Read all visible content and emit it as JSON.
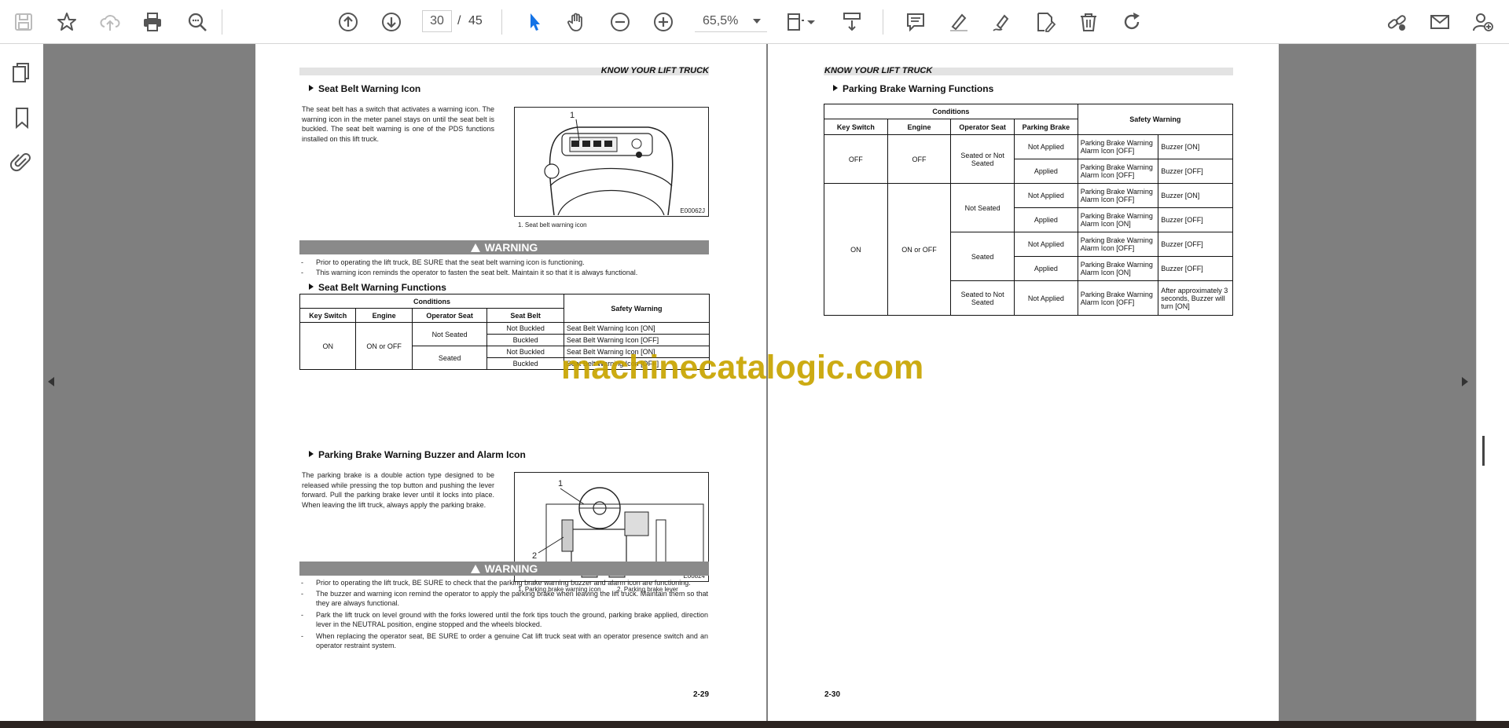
{
  "toolbar": {
    "page_current": "30",
    "page_separator": "/",
    "page_total": "45",
    "zoom": "65,5%"
  },
  "left_page": {
    "header": "KNOW YOUR LIFT TRUCK",
    "sec1_title": "Seat Belt Warning Icon",
    "sec1_para": "The seat belt has a switch that activates a warning icon. The warning icon in the meter panel stays on until the seat belt is buckled. The seat belt warning is one of the PDS functions installed on this lift truck.",
    "fig1_callout": "1",
    "fig1_code": "E00062J",
    "fig1_caption": "1.  Seat belt warning icon",
    "warning1_label": "WARNING",
    "warning1_items": [
      "Prior to operating the lift truck, BE SURE that the seat belt warning icon is functioning.",
      "This warning icon reminds the operator to fasten the seat belt. Maintain it so that it is always functional."
    ],
    "sec2_title": "Seat Belt Warning Functions",
    "table1": {
      "conditions": "Conditions",
      "safety_warning": "Safety Warning",
      "col_key": "Key Switch",
      "col_engine": "Engine",
      "col_seat": "Operator Seat",
      "col_belt": "Seat Belt",
      "key_on": "ON",
      "engine_on_off": "ON or OFF",
      "not_seated": "Not Seated",
      "seated": "Seated",
      "rows": [
        {
          "belt": "Not Buckled",
          "warning": "Seat Belt Warning Icon [ON]"
        },
        {
          "belt": "Buckled",
          "warning": "Seat Belt Warning Icon [OFF]"
        },
        {
          "belt": "Not Buckled",
          "warning": "Seat Belt Warning Icon [ON]"
        },
        {
          "belt": "Buckled",
          "warning": "Seat Belt Warning Icon [OFF]"
        }
      ]
    },
    "sec3_title": "Parking Brake Warning Buzzer and Alarm Icon",
    "sec3_para": "The parking brake is a double action type designed to be released while pressing the top button and pushing the lever forward. Pull the parking brake lever until it locks into place. When leaving the lift truck, always apply the parking brake.",
    "fig2_callout1": "1",
    "fig2_callout2": "2",
    "fig2_code": "E00824",
    "fig2_caption1": "1.  Parking brake warning icon",
    "fig2_caption2": "2.  Parking brake lever",
    "warning2_label": "WARNING",
    "warning2_items": [
      "Prior to operating the lift truck, BE SURE to check that the parking brake warning buzzer and alarm icon are functioning.",
      "The buzzer and warning icon remind the operator to apply the parking brake when leaving the lift truck. Maintain them so that they are always functional.",
      "Park the lift truck on level ground with the forks lowered until the fork tips touch the ground, parking brake applied, direction lever in the NEUTRAL position, engine stopped and the wheels blocked.",
      "When replacing the operator seat, BE SURE to order a genuine Cat lift truck seat with an operator presence switch and an operator restraint system."
    ],
    "page_number": "2-29"
  },
  "right_page": {
    "header": "KNOW YOUR LIFT TRUCK",
    "sec_title": "Parking Brake Warning Functions",
    "table2": {
      "conditions": "Conditions",
      "safety_warning": "Safety Warning",
      "col_key": "Key Switch",
      "col_engine": "Engine",
      "col_seat": "Operator Seat",
      "col_brake": "Parking Brake",
      "off": "OFF",
      "on": "ON",
      "on_or_off": "ON or OFF",
      "seated_or_not": "Seated or Not Seated",
      "not_seated": "Not Seated",
      "seated": "Seated",
      "seated_to_not": "Seated to Not Seated",
      "rows": [
        {
          "brake": "Not Applied",
          "icon": "Parking Brake Warning Alarm Icon [OFF]",
          "buzzer": "Buzzer [ON]"
        },
        {
          "brake": "Applied",
          "icon": "Parking Brake Warning Alarm Icon [OFF]",
          "buzzer": "Buzzer [OFF]"
        },
        {
          "brake": "Not Applied",
          "icon": "Parking Brake Warning Alarm Icon [OFF]",
          "buzzer": "Buzzer [ON]"
        },
        {
          "brake": "Applied",
          "icon": "Parking Brake Warning Alarm Icon [ON]",
          "buzzer": "Buzzer [OFF]"
        },
        {
          "brake": "Not Applied",
          "icon": "Parking Brake Warning Alarm Icon [OFF]",
          "buzzer": "Buzzer [OFF]"
        },
        {
          "brake": "Applied",
          "icon": "Parking Brake Warning Alarm Icon [ON]",
          "buzzer": "Buzzer [OFF]"
        },
        {
          "brake": "Not Applied",
          "icon": "Parking Brake Warning Alarm Icon [OFF]",
          "buzzer": "After approximately 3 seconds, Buzzer will turn [ON]"
        }
      ]
    },
    "page_number": "2-30"
  },
  "watermark": "machinecatalogic.com",
  "colors": {
    "accent_blue": "#1473e6",
    "watermark": "#c8a400",
    "doc_background": "#7f7f7f",
    "warning_bar": "#8a8a8a"
  },
  "icons": [
    "save-icon",
    "bookmark-star-icon",
    "cloud-upload-icon",
    "print-icon",
    "zoom-search-icon",
    "page-up-icon",
    "page-down-icon",
    "select-arrow-icon",
    "hand-icon",
    "zoom-out-icon",
    "zoom-in-icon",
    "fit-page-icon",
    "scroll-mode-icon",
    "comment-icon",
    "highlight-icon",
    "sign-icon",
    "edit-pdf-icon",
    "delete-icon",
    "rotate-icon",
    "share-link-icon",
    "email-icon",
    "add-user-icon",
    "pages-panel-icon",
    "bookmarks-panel-icon",
    "attachments-panel-icon"
  ]
}
